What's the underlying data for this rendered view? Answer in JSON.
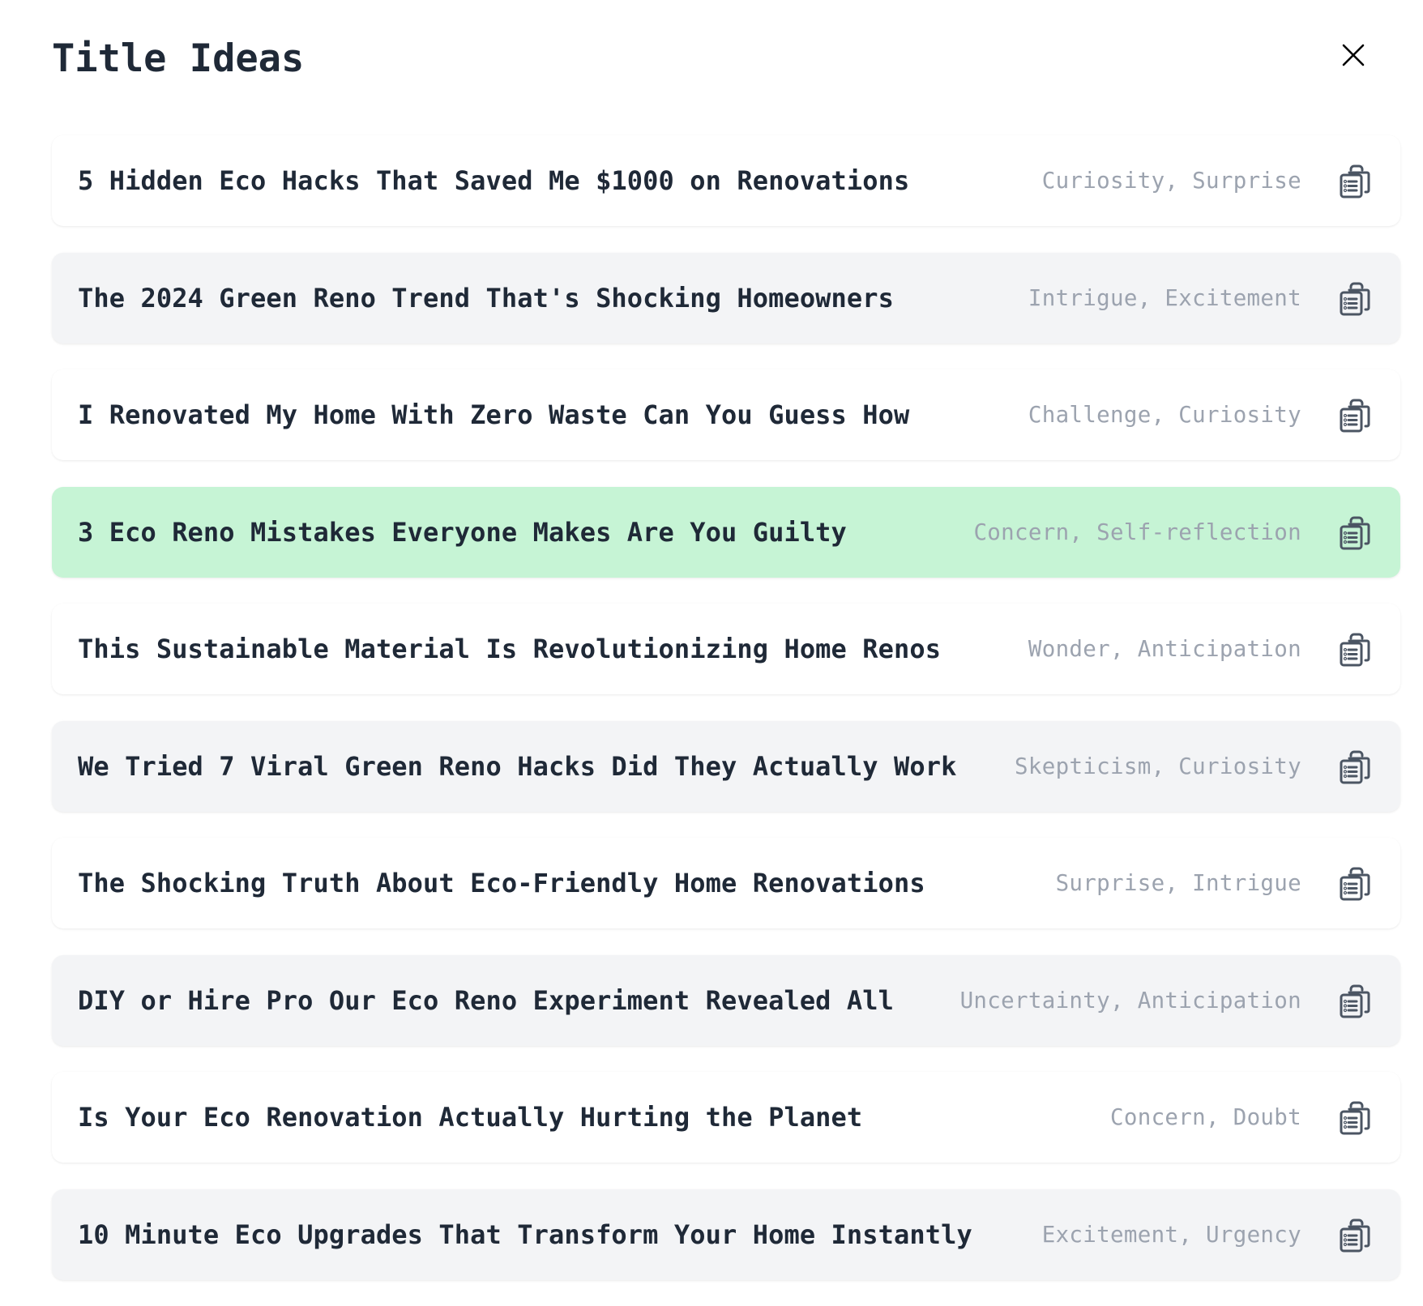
{
  "header": {
    "title": "Title Ideas",
    "close_icon": "close-icon"
  },
  "colors": {
    "title_text": "#1f2937",
    "tag_text": "#9ca3af",
    "row_default_bg": "#ffffff",
    "row_alt_bg": "#f3f4f6",
    "row_selected_bg": "#c6f4d5",
    "icon": "#4b5563"
  },
  "rows": [
    {
      "title": "5 Hidden Eco Hacks That Saved Me $1000 on Renovations",
      "tags": "Curiosity, Surprise",
      "icon": "clipboard-copy-icon",
      "selected": false
    },
    {
      "title": "The 2024 Green Reno Trend That's Shocking Homeowners",
      "tags": "Intrigue, Excitement",
      "icon": "clipboard-copy-icon",
      "selected": false
    },
    {
      "title": "I Renovated My Home With Zero Waste Can You Guess How",
      "tags": "Challenge, Curiosity",
      "icon": "clipboard-copy-icon",
      "selected": false
    },
    {
      "title": "3 Eco Reno Mistakes Everyone Makes Are You Guilty",
      "tags": "Concern, Self-reflection",
      "icon": "clipboard-copy-icon",
      "selected": true
    },
    {
      "title": "This Sustainable Material Is Revolutionizing Home Renos",
      "tags": "Wonder, Anticipation",
      "icon": "clipboard-copy-icon",
      "selected": false
    },
    {
      "title": "We Tried 7 Viral Green Reno Hacks Did They Actually Work",
      "tags": "Skepticism, Curiosity",
      "icon": "clipboard-copy-icon",
      "selected": false
    },
    {
      "title": "The Shocking Truth About Eco-Friendly Home Renovations",
      "tags": "Surprise, Intrigue",
      "icon": "clipboard-copy-icon",
      "selected": false
    },
    {
      "title": "DIY or Hire Pro Our Eco Reno Experiment Revealed All",
      "tags": "Uncertainty, Anticipation",
      "icon": "clipboard-copy-icon",
      "selected": false
    },
    {
      "title": "Is Your Eco Renovation Actually Hurting the Planet",
      "tags": "Concern, Doubt",
      "icon": "clipboard-copy-icon",
      "selected": false
    },
    {
      "title": "10 Minute Eco Upgrades That Transform Your Home Instantly",
      "tags": "Excitement, Urgency",
      "icon": "clipboard-copy-icon",
      "selected": false
    }
  ]
}
